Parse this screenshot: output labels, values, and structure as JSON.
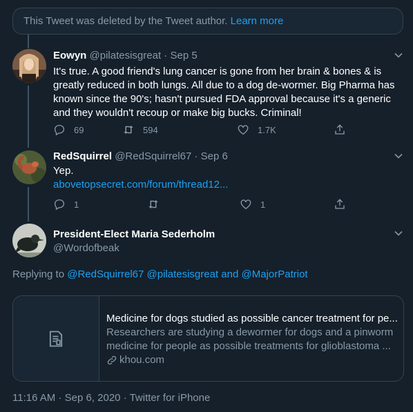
{
  "deleted_notice": {
    "text": "This Tweet was deleted by the Tweet author.",
    "link": "Learn more"
  },
  "tweets": [
    {
      "name": "Eowyn",
      "handle": "@pilatesisgreat",
      "date": "Sep 5",
      "lines": [
        "It's true. A good friend's lung cancer is gone from her brain & bones & is",
        "greatly reduced in both lungs. All due to a dog de-wormer. Big Pharma has",
        "known since the 90's; hasn't pursued FDA approval because it's a generic",
        "and they wouldn't recoup or make big bucks. Criminal!"
      ],
      "replies": "69",
      "retweets": "594",
      "likes": "1.7K"
    },
    {
      "name": "RedSquirrel",
      "handle": "@RedSquirrel67",
      "date": "Sep 6",
      "text": "Yep.",
      "link": "abovetopsecret.com/forum/thread12...",
      "replies": "1",
      "retweets": "",
      "likes": "1"
    },
    {
      "name": "President-Elect Maria Sederholm",
      "handle": "@Wordofbeak"
    }
  ],
  "replying": {
    "prefix": "Replying to",
    "users": [
      "@RedSquirrel67",
      "@pilatesisgreat"
    ],
    "and": "and",
    "last": "@MajorPatriot"
  },
  "card": {
    "title": "Medicine for dogs studied as possible cancer treatment for pe...",
    "description_lines": [
      "Researchers are studying a dewormer for dogs and a pinworm",
      "medicine for people as possible treatments for glioblastoma ..."
    ],
    "domain": "khou.com",
    "icon": "document-icon"
  },
  "footer": {
    "time": "11:16 AM",
    "date": "Sep 6, 2020",
    "source": "Twitter for iPhone"
  },
  "colors": {
    "background": "#15202b",
    "accent": "#1da1f2",
    "secondary_text": "#8899a6",
    "border": "#38444d"
  }
}
